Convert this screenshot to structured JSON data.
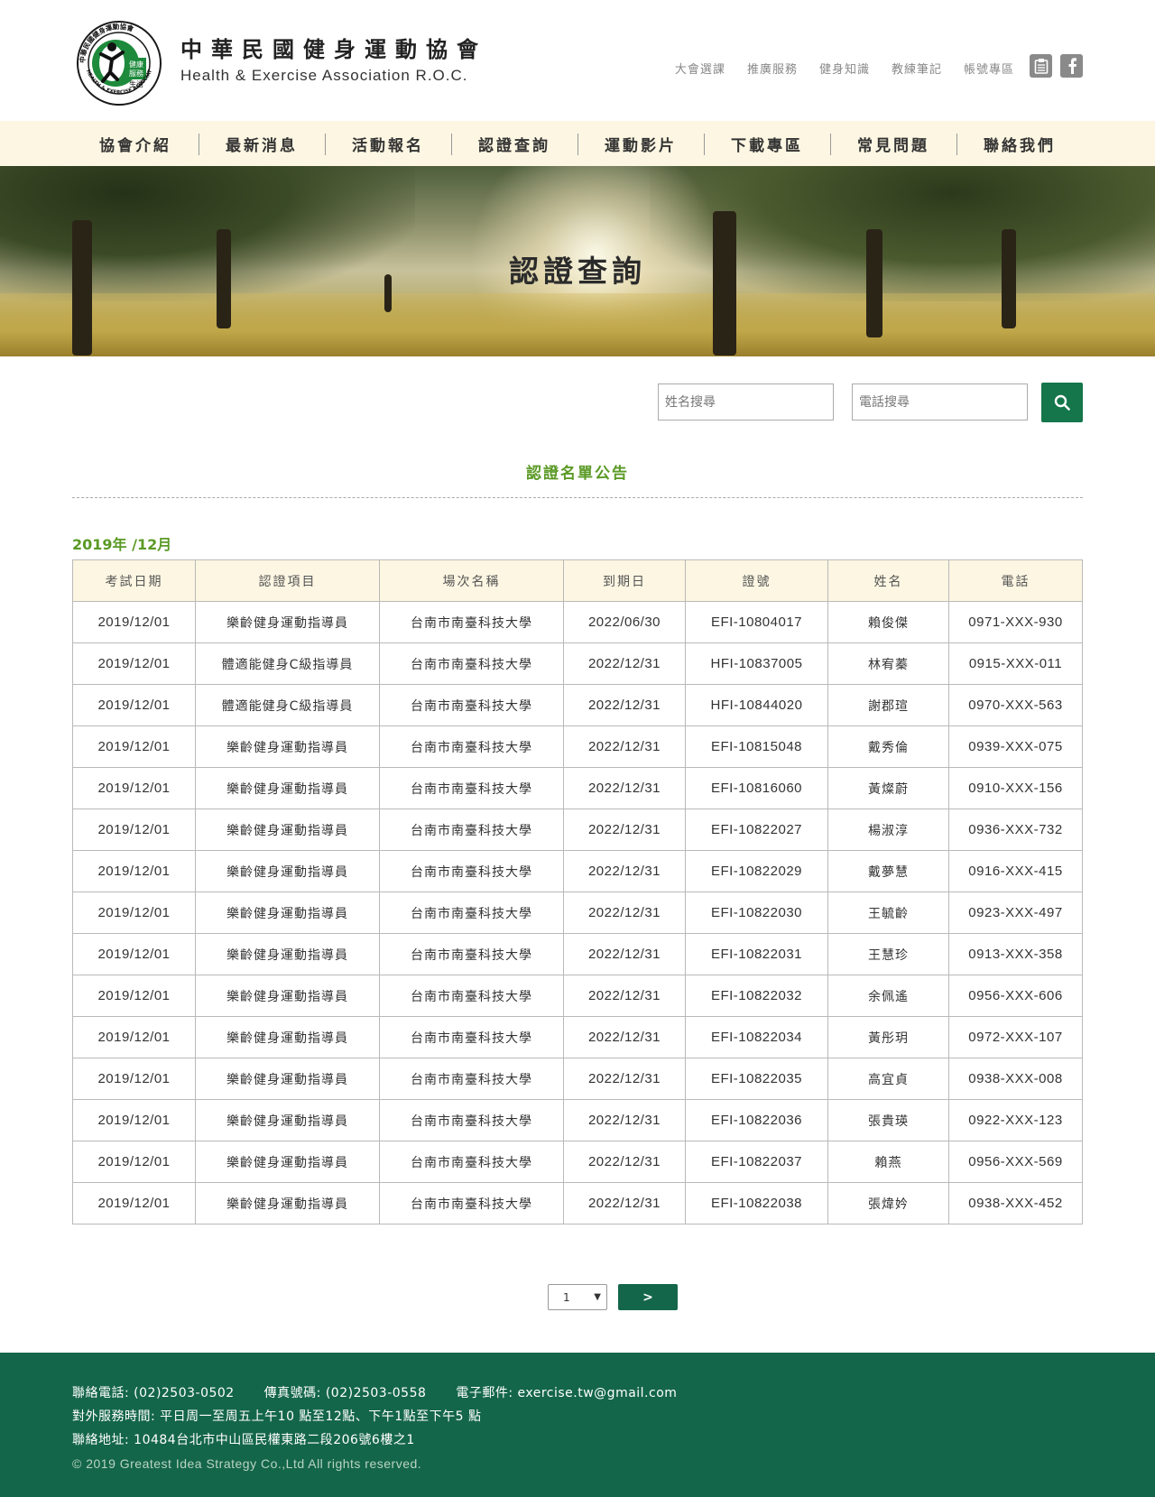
{
  "brand": {
    "name_zh": "中華民國健身運動協會",
    "name_en": "Health & Exercise Association R.O.C.",
    "logo_center_text": "健康服務生活",
    "logo_ring_text": "中華民國健身運動協會 HEALTH & EXERCISE ASSOCIATION R.O.C."
  },
  "top_links": [
    "大會選課",
    "推廣服務",
    "健身知識",
    "教練筆記",
    "帳號專區"
  ],
  "social": [
    "clipboard-icon",
    "facebook-icon"
  ],
  "nav": [
    "協會介紹",
    "最新消息",
    "活動報名",
    "認證查詢",
    "運動影片",
    "下載專區",
    "常見問題",
    "聯絡我們"
  ],
  "banner": {
    "title": "認證查詢"
  },
  "search": {
    "name_placeholder": "姓名搜尋",
    "phone_placeholder": "電話搜尋"
  },
  "section_title": "認證名單公告",
  "month_label": "2019年 /12月",
  "table": {
    "headers": [
      "考試日期",
      "認證項目",
      "場次名稱",
      "到期日",
      "證號",
      "姓名",
      "電話"
    ],
    "rows": [
      [
        "2019/12/01",
        "樂齡健身運動指導員",
        "台南市南臺科技大學",
        "2022/06/30",
        "EFI-10804017",
        "賴俊傑",
        "0971-XXX-930"
      ],
      [
        "2019/12/01",
        "體適能健身C級指導員",
        "台南市南臺科技大學",
        "2022/12/31",
        "HFI-10837005",
        "林宥蓁",
        "0915-XXX-011"
      ],
      [
        "2019/12/01",
        "體適能健身C級指導員",
        "台南市南臺科技大學",
        "2022/12/31",
        "HFI-10844020",
        "謝郡瑄",
        "0970-XXX-563"
      ],
      [
        "2019/12/01",
        "樂齡健身運動指導員",
        "台南市南臺科技大學",
        "2022/12/31",
        "EFI-10815048",
        "戴秀倫",
        "0939-XXX-075"
      ],
      [
        "2019/12/01",
        "樂齡健身運動指導員",
        "台南市南臺科技大學",
        "2022/12/31",
        "EFI-10816060",
        "黃燦蔚",
        "0910-XXX-156"
      ],
      [
        "2019/12/01",
        "樂齡健身運動指導員",
        "台南市南臺科技大學",
        "2022/12/31",
        "EFI-10822027",
        "楊淑淳",
        "0936-XXX-732"
      ],
      [
        "2019/12/01",
        "樂齡健身運動指導員",
        "台南市南臺科技大學",
        "2022/12/31",
        "EFI-10822029",
        "戴夢慧",
        "0916-XXX-415"
      ],
      [
        "2019/12/01",
        "樂齡健身運動指導員",
        "台南市南臺科技大學",
        "2022/12/31",
        "EFI-10822030",
        "王毓齡",
        "0923-XXX-497"
      ],
      [
        "2019/12/01",
        "樂齡健身運動指導員",
        "台南市南臺科技大學",
        "2022/12/31",
        "EFI-10822031",
        "王慧珍",
        "0913-XXX-358"
      ],
      [
        "2019/12/01",
        "樂齡健身運動指導員",
        "台南市南臺科技大學",
        "2022/12/31",
        "EFI-10822032",
        "余佩遙",
        "0956-XXX-606"
      ],
      [
        "2019/12/01",
        "樂齡健身運動指導員",
        "台南市南臺科技大學",
        "2022/12/31",
        "EFI-10822034",
        "黃彤玥",
        "0972-XXX-107"
      ],
      [
        "2019/12/01",
        "樂齡健身運動指導員",
        "台南市南臺科技大學",
        "2022/12/31",
        "EFI-10822035",
        "高宜貞",
        "0938-XXX-008"
      ],
      [
        "2019/12/01",
        "樂齡健身運動指導員",
        "台南市南臺科技大學",
        "2022/12/31",
        "EFI-10822036",
        "張貴瑛",
        "0922-XXX-123"
      ],
      [
        "2019/12/01",
        "樂齡健身運動指導員",
        "台南市南臺科技大學",
        "2022/12/31",
        "EFI-10822037",
        "賴燕",
        "0956-XXX-569"
      ],
      [
        "2019/12/01",
        "樂齡健身運動指導員",
        "台南市南臺科技大學",
        "2022/12/31",
        "EFI-10822038",
        "張煒妗",
        "0938-XXX-452"
      ]
    ]
  },
  "pagination": {
    "page": "1",
    "next_label": ">"
  },
  "footer": {
    "phone": "聯絡電話: (02)2503-0502",
    "fax": "傳真號碼: (02)2503-0558",
    "email": "電子郵件: exercise.tw@gmail.com",
    "hours": "對外服務時間: 平日周一至周五上午10 點至12點、下午1點至下午5 點",
    "address": "聯絡地址: 10484台北市中山區民權東路二段206號6樓之1",
    "copyright": "© 2019 Greatest Idea Strategy Co.,Ltd All rights reserved."
  },
  "colors": {
    "accent_green": "#14664a",
    "title_green": "#5b9a26",
    "nav_bg": "#fcf6e2"
  }
}
